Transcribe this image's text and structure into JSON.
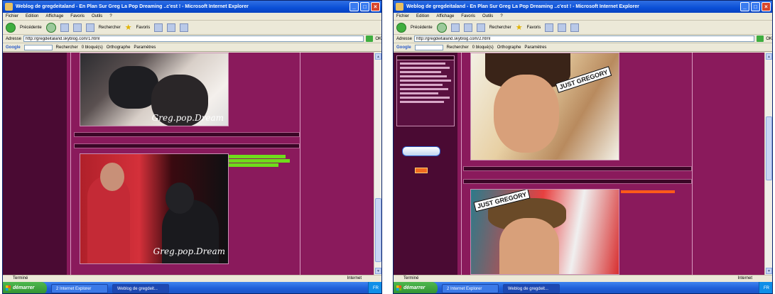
{
  "left": {
    "title": "Weblog de gregdeitaland - En Plan Sur Greg La Pop Dreaming ..c'est ! - Microsoft Internet Explorer",
    "menu": [
      "Fichier",
      "Edition",
      "Affichage",
      "Favoris",
      "Outils",
      "?"
    ],
    "toolbar": {
      "back": "Précédente",
      "search": "Rechercher",
      "favorites": "Favoris"
    },
    "address": {
      "label": "Adresse",
      "value": "http://gregdeitaland.skyblog.com/1.html",
      "go": "OK"
    },
    "google": {
      "logo": "Google",
      "search": "Rechercher",
      "blocked": "0 bloqué(s)",
      "spell": "Orthographe",
      "options": "Paramètres"
    },
    "status": {
      "text": "Terminé",
      "zone": "Internet"
    },
    "taskbar": {
      "start": "démarrer",
      "tasks": [
        "2 Internet Explorer",
        "Weblog de gregdeit..."
      ],
      "tray": "FR"
    },
    "watermark": "Greg.pop.Dream"
  },
  "right": {
    "title": "Weblog de gregdeitaland - En Plan Sur Greg La Pop Dreaming ..c'est ! - Microsoft Internet Explorer",
    "menu": [
      "Fichier",
      "Edition",
      "Affichage",
      "Favoris",
      "Outils",
      "?"
    ],
    "toolbar": {
      "back": "Précédente",
      "search": "Rechercher",
      "favorites": "Favoris"
    },
    "address": {
      "label": "Adresse",
      "value": "http://gregdeitaland.skyblog.com/2.html",
      "go": "OK"
    },
    "google": {
      "logo": "Google",
      "search": "Rechercher",
      "blocked": "0 bloqué(s)",
      "spell": "Orthographe",
      "options": "Paramètres"
    },
    "status": {
      "text": "Terminé",
      "zone": "Internet"
    },
    "taskbar": {
      "start": "démarrer",
      "tasks": [
        "2 Internet Explorer",
        "Weblog de gregdeit..."
      ],
      "tray": "FR"
    },
    "sticker_text": "JUST GREGORY"
  },
  "colors": {
    "page_bg": "#8a1a5c",
    "dark_col": "#4a0a33",
    "highlight": "#6fdc1c",
    "title_bar": "#0a4fd6"
  }
}
